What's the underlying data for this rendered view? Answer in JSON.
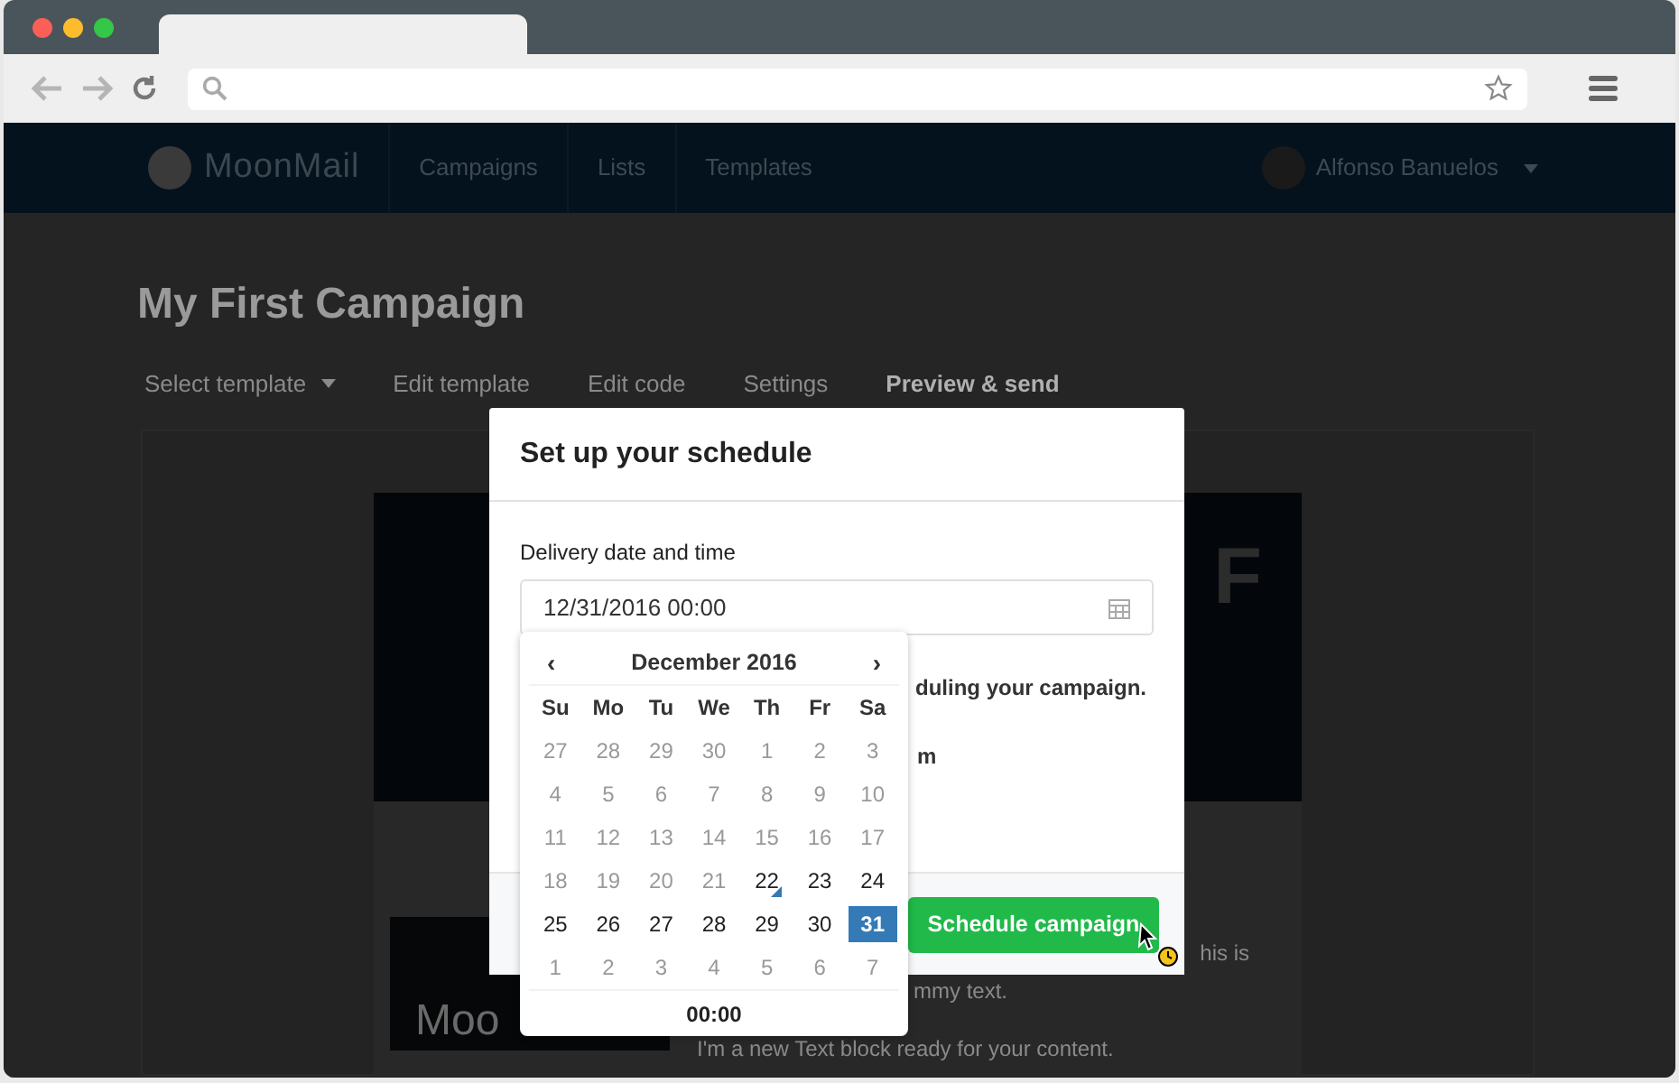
{
  "header": {
    "logo": "MoonMail",
    "nav": [
      {
        "label": "Campaigns",
        "selected": false
      },
      {
        "label": "Lists",
        "selected": false
      },
      {
        "label": "Templates",
        "selected": false
      }
    ],
    "user": "Alfonso Banuelos"
  },
  "page": {
    "title": "My First Campaign",
    "tabs": [
      {
        "label": "Select template",
        "kind": "dropdown",
        "selected": false
      },
      {
        "label": "Edit template",
        "kind": "tab",
        "selected": false
      },
      {
        "label": "Edit code",
        "kind": "tab",
        "selected": false
      },
      {
        "label": "Settings",
        "kind": "tab",
        "selected": false
      },
      {
        "label": "Preview & send",
        "kind": "tab",
        "selected": true
      }
    ]
  },
  "preview": {
    "headline": "F",
    "image_text": "Moo",
    "paragraphs": [
      "his is",
      "mmy text.",
      "I'm a new Text block ready for your content."
    ]
  },
  "modal": {
    "title": "Set up your schedule",
    "field_label": "Delivery date and time",
    "field_value": "12/31/2016 00:00",
    "notes": [
      "duling your campaign.",
      "m"
    ],
    "button": "Schedule campaign"
  },
  "calendar": {
    "prev": "‹",
    "month": "December 2016",
    "next": "›",
    "weekdays": [
      "Su",
      "Mo",
      "Tu",
      "We",
      "Th",
      "Fr",
      "Sa"
    ],
    "weeks": [
      [
        {
          "day": "27",
          "muted": true,
          "today": false,
          "selected": false
        },
        {
          "day": "28",
          "muted": true,
          "today": false,
          "selected": false
        },
        {
          "day": "29",
          "muted": true,
          "today": false,
          "selected": false
        },
        {
          "day": "30",
          "muted": true,
          "today": false,
          "selected": false
        },
        {
          "day": "1",
          "muted": true,
          "today": false,
          "selected": false
        },
        {
          "day": "2",
          "muted": true,
          "today": false,
          "selected": false
        },
        {
          "day": "3",
          "muted": true,
          "today": false,
          "selected": false
        }
      ],
      [
        {
          "day": "4",
          "muted": true,
          "today": false,
          "selected": false
        },
        {
          "day": "5",
          "muted": true,
          "today": false,
          "selected": false
        },
        {
          "day": "6",
          "muted": true,
          "today": false,
          "selected": false
        },
        {
          "day": "7",
          "muted": true,
          "today": false,
          "selected": false
        },
        {
          "day": "8",
          "muted": true,
          "today": false,
          "selected": false
        },
        {
          "day": "9",
          "muted": true,
          "today": false,
          "selected": false
        },
        {
          "day": "10",
          "muted": true,
          "today": false,
          "selected": false
        }
      ],
      [
        {
          "day": "11",
          "muted": true,
          "today": false,
          "selected": false
        },
        {
          "day": "12",
          "muted": true,
          "today": false,
          "selected": false
        },
        {
          "day": "13",
          "muted": true,
          "today": false,
          "selected": false
        },
        {
          "day": "14",
          "muted": true,
          "today": false,
          "selected": false
        },
        {
          "day": "15",
          "muted": true,
          "today": false,
          "selected": false
        },
        {
          "day": "16",
          "muted": true,
          "today": false,
          "selected": false
        },
        {
          "day": "17",
          "muted": true,
          "today": false,
          "selected": false
        }
      ],
      [
        {
          "day": "18",
          "muted": true,
          "today": false,
          "selected": false
        },
        {
          "day": "19",
          "muted": true,
          "today": false,
          "selected": false
        },
        {
          "day": "20",
          "muted": true,
          "today": false,
          "selected": false
        },
        {
          "day": "21",
          "muted": true,
          "today": false,
          "selected": false
        },
        {
          "day": "22",
          "muted": false,
          "today": true,
          "selected": false
        },
        {
          "day": "23",
          "muted": false,
          "today": false,
          "selected": false
        },
        {
          "day": "24",
          "muted": false,
          "today": false,
          "selected": false
        }
      ],
      [
        {
          "day": "25",
          "muted": false,
          "today": false,
          "selected": false
        },
        {
          "day": "26",
          "muted": false,
          "today": false,
          "selected": false
        },
        {
          "day": "27",
          "muted": false,
          "today": false,
          "selected": false
        },
        {
          "day": "28",
          "muted": false,
          "today": false,
          "selected": false
        },
        {
          "day": "29",
          "muted": false,
          "today": false,
          "selected": false
        },
        {
          "day": "30",
          "muted": false,
          "today": false,
          "selected": false
        },
        {
          "day": "31",
          "muted": false,
          "today": false,
          "selected": true
        }
      ],
      [
        {
          "day": "1",
          "muted": true,
          "today": false,
          "selected": false
        },
        {
          "day": "2",
          "muted": true,
          "today": false,
          "selected": false
        },
        {
          "day": "3",
          "muted": true,
          "today": false,
          "selected": false
        },
        {
          "day": "4",
          "muted": true,
          "today": false,
          "selected": false
        },
        {
          "day": "5",
          "muted": true,
          "today": false,
          "selected": false
        },
        {
          "day": "6",
          "muted": true,
          "today": false,
          "selected": false
        },
        {
          "day": "7",
          "muted": true,
          "today": false,
          "selected": false
        }
      ]
    ],
    "time": "00:00"
  }
}
